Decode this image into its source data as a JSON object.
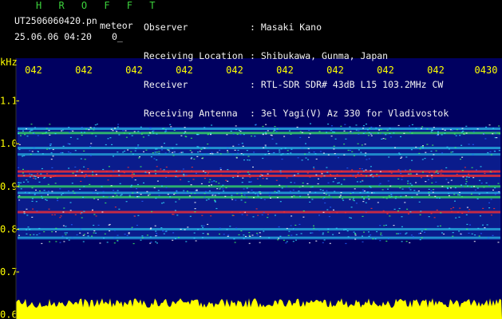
{
  "header": {
    "title": "H R O F F T",
    "filename": "UT2506060420.pn",
    "tag": "meteor",
    "datetime": "25.06.06 04:20",
    "sub": "0_",
    "fields": [
      {
        "label": "Observer",
        "value": ": Masaki Kano"
      },
      {
        "label": "Receiving Location",
        "value": ": Shibukawa, Gunma, Japan"
      },
      {
        "label": "Receiver",
        "value": ": RTL-SDR SDR# 43dB L15 103.2MHz CW"
      },
      {
        "label": "Receiving Antenna",
        "value": ": 3el Yagi(V) Az 330 for Vladivostok"
      }
    ]
  },
  "colors": {
    "background": "#000000",
    "plot_background": "#000060",
    "band_signal": "#ff3030",
    "noise_cyan": "#30e0ff",
    "noise_green": "#40ff60",
    "yellow": "#ffff00",
    "header_green": "#3cd23c"
  },
  "chart_data": {
    "type": "heatmap",
    "title": "",
    "ylabel": "kHz",
    "xlabel": "",
    "x_tick_labels": [
      "042",
      "042",
      "042",
      "042",
      "042",
      "042",
      "042",
      "042",
      "042",
      "0430"
    ],
    "y_ticks": [
      1.1,
      1.0,
      0.9,
      0.8,
      0.7,
      0.6
    ],
    "y_tick_labels": [
      "1.1",
      "1.0",
      "0.9",
      "0.8",
      "0.7",
      "0.6"
    ],
    "ylim": [
      0.59,
      1.2
    ],
    "signal_band_khz": [
      0.775,
      1.04
    ],
    "bands": [
      {
        "khz": 1.035,
        "intensity": 0.55
      },
      {
        "khz": 1.025,
        "intensity": 0.7
      },
      {
        "khz": 0.99,
        "intensity": 0.55
      },
      {
        "khz": 0.975,
        "intensity": 0.45
      },
      {
        "khz": 0.935,
        "intensity": 1.0
      },
      {
        "khz": 0.925,
        "intensity": 0.95
      },
      {
        "khz": 0.9,
        "intensity": 0.65
      },
      {
        "khz": 0.885,
        "intensity": 0.55
      },
      {
        "khz": 0.875,
        "intensity": 0.7
      },
      {
        "khz": 0.84,
        "intensity": 0.9
      },
      {
        "khz": 0.8,
        "intensity": 0.55
      },
      {
        "khz": 0.78,
        "intensity": 0.5
      }
    ],
    "power_trace_label": "yellow noise power bar"
  }
}
